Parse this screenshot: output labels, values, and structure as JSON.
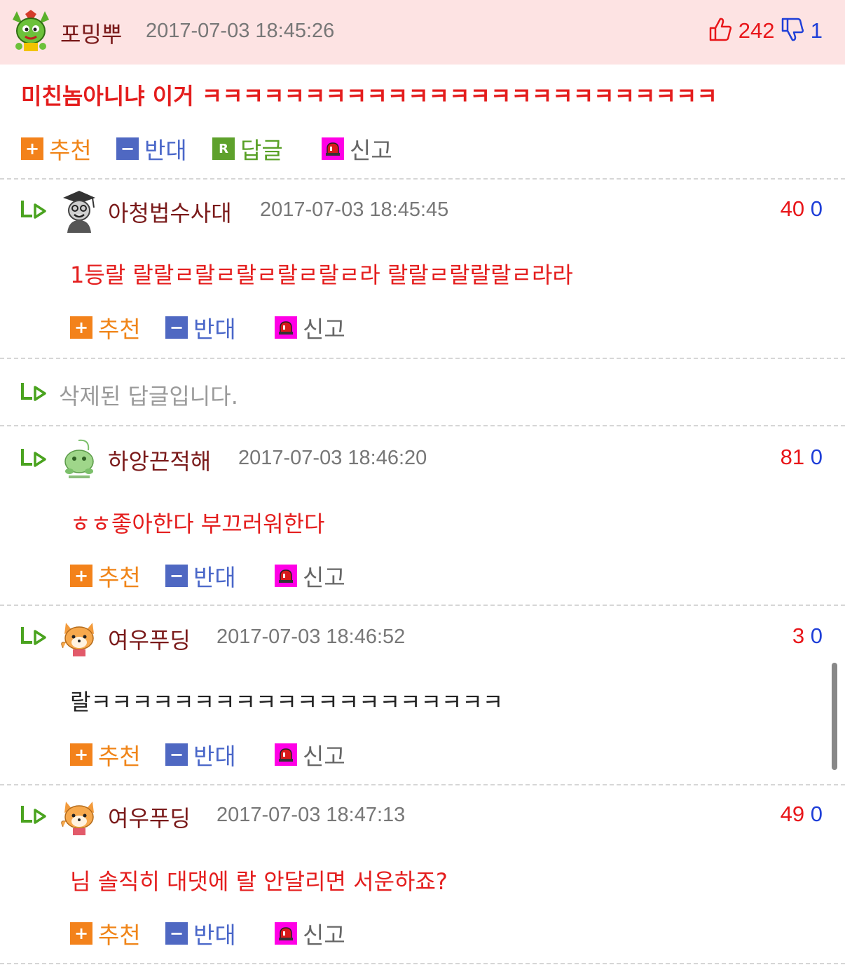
{
  "colors": {
    "best_bg": "#fde3e3",
    "vote_up": "#e8161a",
    "vote_down": "#1f3fd8",
    "nick": "#7a1a1a",
    "red_text": "#e41d1d",
    "recommend_accent": "#f3821b",
    "oppose_accent": "#4f68c2",
    "reply_accent": "#5ea12c",
    "report_accent": "#ff00e6"
  },
  "actions": {
    "recommend": "추천",
    "oppose": "반대",
    "reply": "답글",
    "report": "신고"
  },
  "best": {
    "nickname": "포밍뿌",
    "date": "2017-07-03 18:45:26",
    "up": "242",
    "down": "1",
    "text": "미친놈아니냐 이거 ㅋㅋㅋㅋㅋㅋㅋㅋㅋㅋㅋㅋㅋㅋㅋㅋㅋㅋㅋㅋㅋㅋㅋㅋㅋ",
    "avatar_icon": "green-goblin-avatar-icon"
  },
  "replies": [
    {
      "nickname": "아청법수사대",
      "date": "2017-07-03 18:45:45",
      "up": "40",
      "down": "0",
      "text": "1등랄 랄랄ㄹ랄ㄹ랄ㄹ랄ㄹ랄ㄹ라 랄랄ㄹ랄랄랄ㄹ라라",
      "avatar_icon": "graduate-avatar-icon"
    },
    {
      "deleted_text": "삭제된 답글입니다."
    },
    {
      "nickname": "하앙끈적해",
      "date": "2017-07-03 18:46:20",
      "up": "81",
      "down": "0",
      "text": "ㅎㅎ좋아한다 부끄러워한다",
      "avatar_icon": "green-frog-avatar-icon"
    },
    {
      "nickname": "여우푸딩",
      "date": "2017-07-03 18:46:52",
      "up": "3",
      "down": "0",
      "text": "랄ㅋㅋㅋㅋㅋㅋㅋㅋㅋㅋㅋㅋㅋㅋㅋㅋㅋㅋㅋㅋ",
      "avatar_icon": "fox-avatar-icon"
    },
    {
      "nickname": "여우푸딩",
      "date": "2017-07-03 18:47:13",
      "up": "49",
      "down": "0",
      "text": "님 솔직히 대댓에 랄 안달리면 서운하죠?",
      "avatar_icon": "fox-avatar-icon"
    }
  ]
}
